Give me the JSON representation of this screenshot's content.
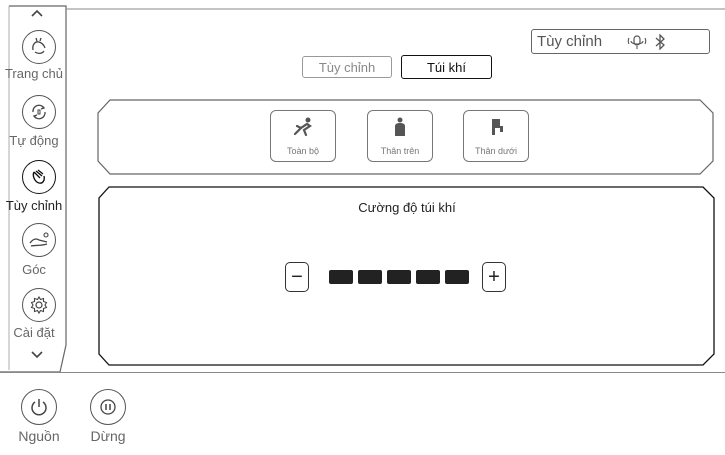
{
  "sidebar": {
    "items": [
      {
        "label": "Trang chủ",
        "icon": "hand-wave-icon"
      },
      {
        "label": "Tự động",
        "icon": "auto-cycle-icon"
      },
      {
        "label": "Tùy chỉnh",
        "icon": "hand-custom-icon"
      },
      {
        "label": "Góc",
        "icon": "recline-angle-icon"
      },
      {
        "label": "Cài đặt",
        "icon": "gear-icon"
      }
    ],
    "selected": "Tùy chỉnh"
  },
  "bottom": {
    "power_label": "Nguồn",
    "pause_label": "Dừng"
  },
  "header": {
    "status_text": "Tùy chỉnh",
    "status_icons": [
      "voice-icon",
      "bluetooth-icon"
    ]
  },
  "tabs": [
    {
      "label": "Tùy chỉnh",
      "active": false
    },
    {
      "label": "Túi khí",
      "active": true
    }
  ],
  "modes": [
    {
      "label": "Toàn bộ",
      "icon": "full-body-chair-icon"
    },
    {
      "label": "Thân trên",
      "icon": "upper-body-icon"
    },
    {
      "label": "Thân dưới",
      "icon": "lower-body-icon"
    }
  ],
  "intensity": {
    "title": "Cường độ túi khí",
    "level": 5,
    "max_level": 5,
    "minus_label": "−",
    "plus_label": "+"
  }
}
